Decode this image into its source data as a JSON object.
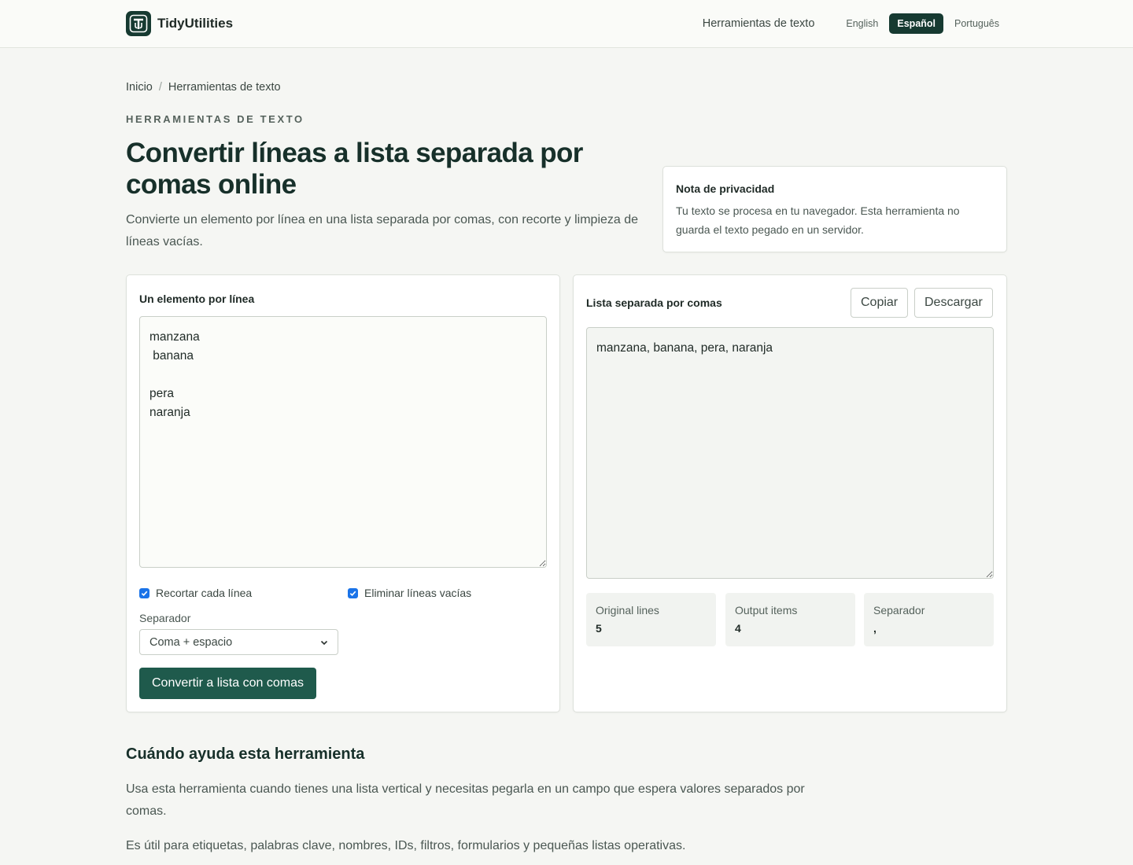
{
  "header": {
    "brand_name": "TidyUtilities",
    "nav_link": "Herramientas de texto",
    "languages": [
      "English",
      "Español",
      "Português"
    ],
    "active_language": "Español"
  },
  "breadcrumb": [
    "Inicio",
    "Herramientas de texto"
  ],
  "eyebrow": "HERRAMIENTAS DE TEXTO",
  "title": "Convertir líneas a lista separada por comas online",
  "lead": "Convierte un elemento por línea en una lista separada por comas, con recorte y limpieza de líneas vacías.",
  "privacy": {
    "title": "Nota de privacidad",
    "text": "Tu texto se procesa en tu navegador. Esta herramienta no guarda el texto pegado en un servidor."
  },
  "input_panel": {
    "label": "Un elemento por línea",
    "value": "manzana\n banana\n\npera\nnaranja",
    "trim_label": "Recortar cada línea",
    "remove_empty_label": "Eliminar líneas vacías",
    "separator_label": "Separador",
    "separator_value": "Coma + espacio",
    "convert_button": "Convertir a lista con comas"
  },
  "output_panel": {
    "label": "Lista separada por comas",
    "copy_button": "Copiar",
    "download_button": "Descargar",
    "value": "manzana, banana, pera, naranja",
    "stats": [
      {
        "label": "Original lines",
        "value": "5"
      },
      {
        "label": "Output items",
        "value": "4"
      },
      {
        "label": "Separador",
        "value": ","
      }
    ]
  },
  "section": {
    "title": "Cuándo ayuda esta herramienta",
    "paragraphs": [
      "Usa esta herramienta cuando tienes una lista vertical y necesitas pegarla en un campo que espera valores separados por comas.",
      "Es útil para etiquetas, palabras clave, nombres, IDs, filtros, formularios y pequeñas listas operativas."
    ]
  },
  "colors": {
    "brand": "#163a31",
    "primary_button": "#1f5a4c",
    "checkbox": "#1a73e8",
    "background": "#f5f6f3"
  }
}
